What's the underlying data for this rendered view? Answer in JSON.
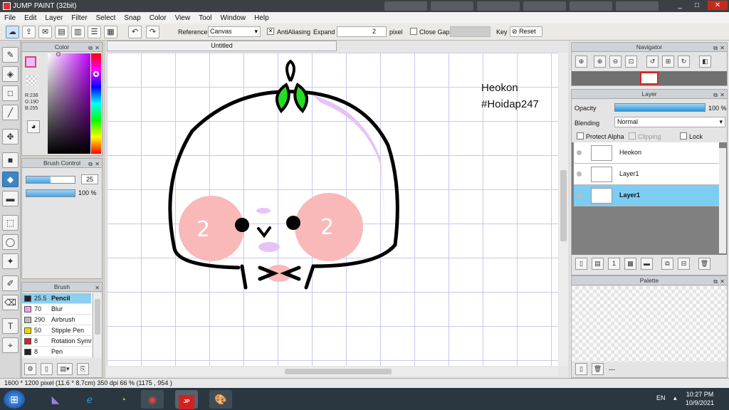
{
  "window": {
    "title": "JUMP PAINT (32bit)",
    "controls": [
      "_",
      "□",
      "✕"
    ]
  },
  "menu": [
    "File",
    "Edit",
    "Layer",
    "Filter",
    "Select",
    "Snap",
    "Color",
    "View",
    "Tool",
    "Window",
    "Help"
  ],
  "toolbar": {
    "reference_label": "Reference",
    "reference_value": "Canvas",
    "antialiasing_label": "AntiAliasing",
    "expand_label": "Expand",
    "expand_value": "2",
    "pixel_label": "pixel",
    "close_gaps_label": "Close Gaps",
    "key_label": "Key",
    "reset_label": "Reset"
  },
  "color_panel": {
    "title": "Color",
    "r": "R:236",
    "g": "G:190",
    "b": "B:255"
  },
  "brush_control": {
    "title": "Brush Control",
    "size": "25",
    "opacity": "100 %",
    "opacity_value": 100
  },
  "brush_panel": {
    "title": "Brush",
    "items": [
      {
        "size": "25.5",
        "name": "Pencil",
        "color": "#222222",
        "selected": true
      },
      {
        "size": "70",
        "name": "Blur",
        "color": "#f0a0f0",
        "selected": false
      },
      {
        "size": "290",
        "name": "Airbrush",
        "color": "#bbbbbb",
        "selected": false
      },
      {
        "size": "50",
        "name": "Stipple Pen",
        "color": "#f0d800",
        "selected": false
      },
      {
        "size": "8",
        "name": "Rotation Symm",
        "color": "#e02020",
        "selected": false
      },
      {
        "size": "8",
        "name": "Pen",
        "color": "#222222",
        "selected": false
      }
    ]
  },
  "document": {
    "tab": "Untitled",
    "watermark_name": "Heokon",
    "watermark_tag": "#Hoidap247"
  },
  "navigator": {
    "title": "Navigator"
  },
  "layer_panel": {
    "title": "Layer",
    "opacity_label": "Opacity",
    "opacity_value": "100 %",
    "opacity_num": 100,
    "blending_label": "Blending",
    "blending_value": "Normal",
    "protect_alpha": "Protect Alpha",
    "clipping": "Clipping",
    "lock": "Lock",
    "layers": [
      {
        "name": "Heokon",
        "selected": false
      },
      {
        "name": "Layer1",
        "selected": false
      },
      {
        "name": "Layer1",
        "selected": true
      }
    ]
  },
  "palette": {
    "title": "Palette",
    "footer": "---"
  },
  "status": "1600 * 1200 pixel  (11.6 * 8.7cm)  350 dpi  66 %  (1175 , 954 )",
  "taskbar": {
    "lang": "EN",
    "time": "10:27 PM",
    "date": "10/9/2021"
  },
  "colors": {
    "accent": "#3d86c6",
    "selected_row": "#8ccfee",
    "fg_color": "#ecbeff"
  }
}
